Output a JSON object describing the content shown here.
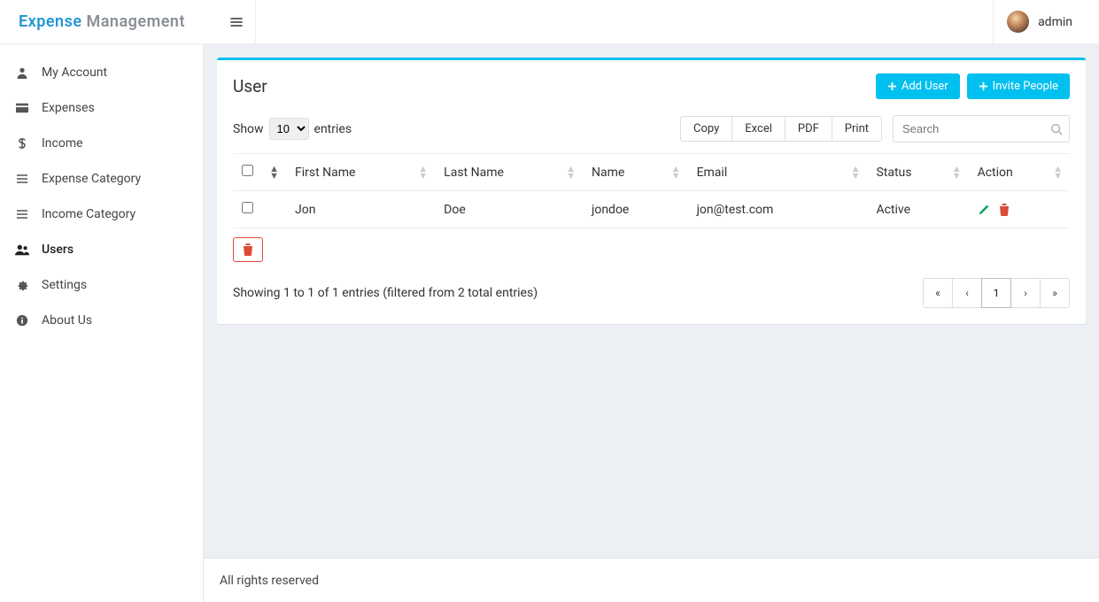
{
  "brand": {
    "part1": "Expense",
    "part2": "Management"
  },
  "header": {
    "username": "admin"
  },
  "sidebar": {
    "items": [
      {
        "label": "My Account",
        "icon": "user-icon",
        "active": false
      },
      {
        "label": "Expenses",
        "icon": "credit-card-icon",
        "active": false
      },
      {
        "label": "Income",
        "icon": "dollar-icon",
        "active": false
      },
      {
        "label": "Expense Category",
        "icon": "list-icon",
        "active": false
      },
      {
        "label": "Income Category",
        "icon": "list-icon",
        "active": false
      },
      {
        "label": "Users",
        "icon": "users-icon",
        "active": true
      },
      {
        "label": "Settings",
        "icon": "gears-icon",
        "active": false
      },
      {
        "label": "About Us",
        "icon": "info-icon",
        "active": false
      }
    ]
  },
  "page": {
    "title": "User",
    "add_user_label": "Add User",
    "invite_label": "Invite People"
  },
  "datatable": {
    "length_prefix": "Show",
    "length_value": "10",
    "length_suffix": "entries",
    "buttons": [
      "Copy",
      "Excel",
      "PDF",
      "Print"
    ],
    "search_placeholder": "Search",
    "columns": [
      "",
      "First Name",
      "Last Name",
      "Name",
      "Email",
      "Status",
      "Action"
    ],
    "rows": [
      {
        "first_name": "Jon",
        "last_name": "Doe",
        "name": "jondoe",
        "email": "jon@test.com",
        "status": "Active"
      }
    ],
    "info": "Showing 1 to 1 of 1 entries (filtered from 2 total entries)",
    "pages": [
      "1"
    ]
  },
  "footer": {
    "text": "All rights reserved"
  }
}
